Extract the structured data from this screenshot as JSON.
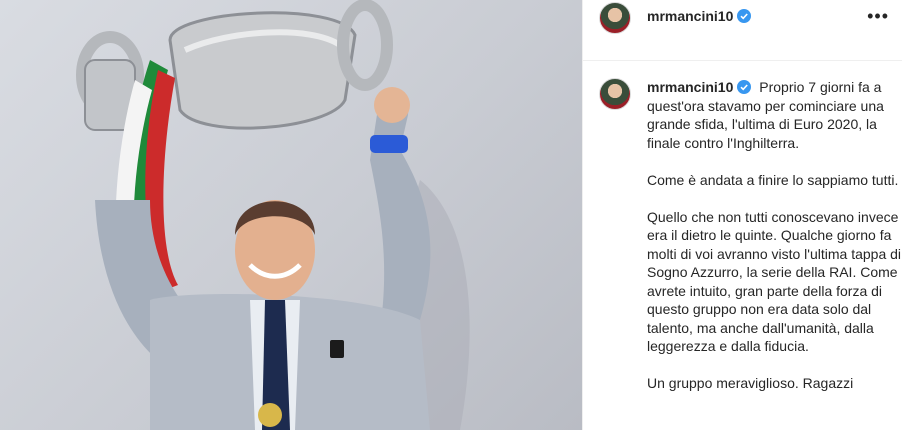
{
  "post": {
    "username": "mrmancini10",
    "more_icon": "more-horizontal-icon",
    "verified_icon": "verified-badge-icon",
    "accent_color": "#3897f0"
  },
  "caption": {
    "paragraphs": [
      "Proprio 7 giorni fa a quest'ora stavamo per cominciare una grande sfida, l'ultima di Euro 2020, la finale contro l'Inghilterra.",
      "Come è andata a finire lo sappiamo tutti.",
      "Quello che non tutti conoscevano invece era il dietro le quinte. Qualche giorno fa molti di voi avranno visto l'ultima tappa di Sogno Azzurro, la serie della RAI. Come avrete intuito, gran parte della forza di questo gruppo non era data solo dal talento, ma anche dall'umanità, dalla leggerezza e dalla fiducia.",
      "Un gruppo meraviglioso. Ragazzi"
    ]
  }
}
